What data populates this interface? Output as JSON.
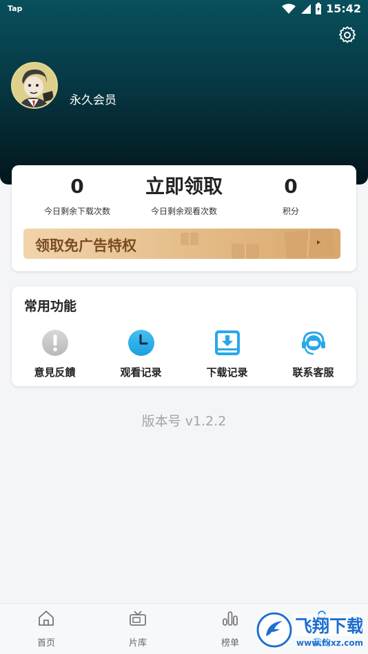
{
  "status_bar": {
    "app": "Tap",
    "time": "15:42"
  },
  "profile": {
    "member_label": "永久会员"
  },
  "stats": [
    {
      "value": "0",
      "label": "今日剩余下载次数"
    },
    {
      "value": "立即领取",
      "label": "今日剩余观看次数"
    },
    {
      "value": "0",
      "label": "积分"
    }
  ],
  "promo": {
    "label": "领取免广告特权"
  },
  "functions": {
    "title": "常用功能",
    "items": [
      {
        "label": "意見反饋",
        "icon": "exclamation-icon"
      },
      {
        "label": "观看记录",
        "icon": "clock-icon"
      },
      {
        "label": "下载记录",
        "icon": "download-icon"
      },
      {
        "label": "联系客服",
        "icon": "headset-icon"
      }
    ]
  },
  "version": "版本号 v1.2.2",
  "tabs": [
    {
      "label": "首页",
      "icon": "home-icon"
    },
    {
      "label": "片库",
      "icon": "tv-icon"
    },
    {
      "label": "榜单",
      "icon": "chart-icon"
    },
    {
      "label": "我的",
      "icon": "profile-icon"
    }
  ],
  "watermark": {
    "text": "飞翔下载",
    "url": "www.fxxz.com"
  },
  "colors": {
    "header": "#063844",
    "accent": "#1e88e5",
    "promo_text": "#7a4c24"
  }
}
